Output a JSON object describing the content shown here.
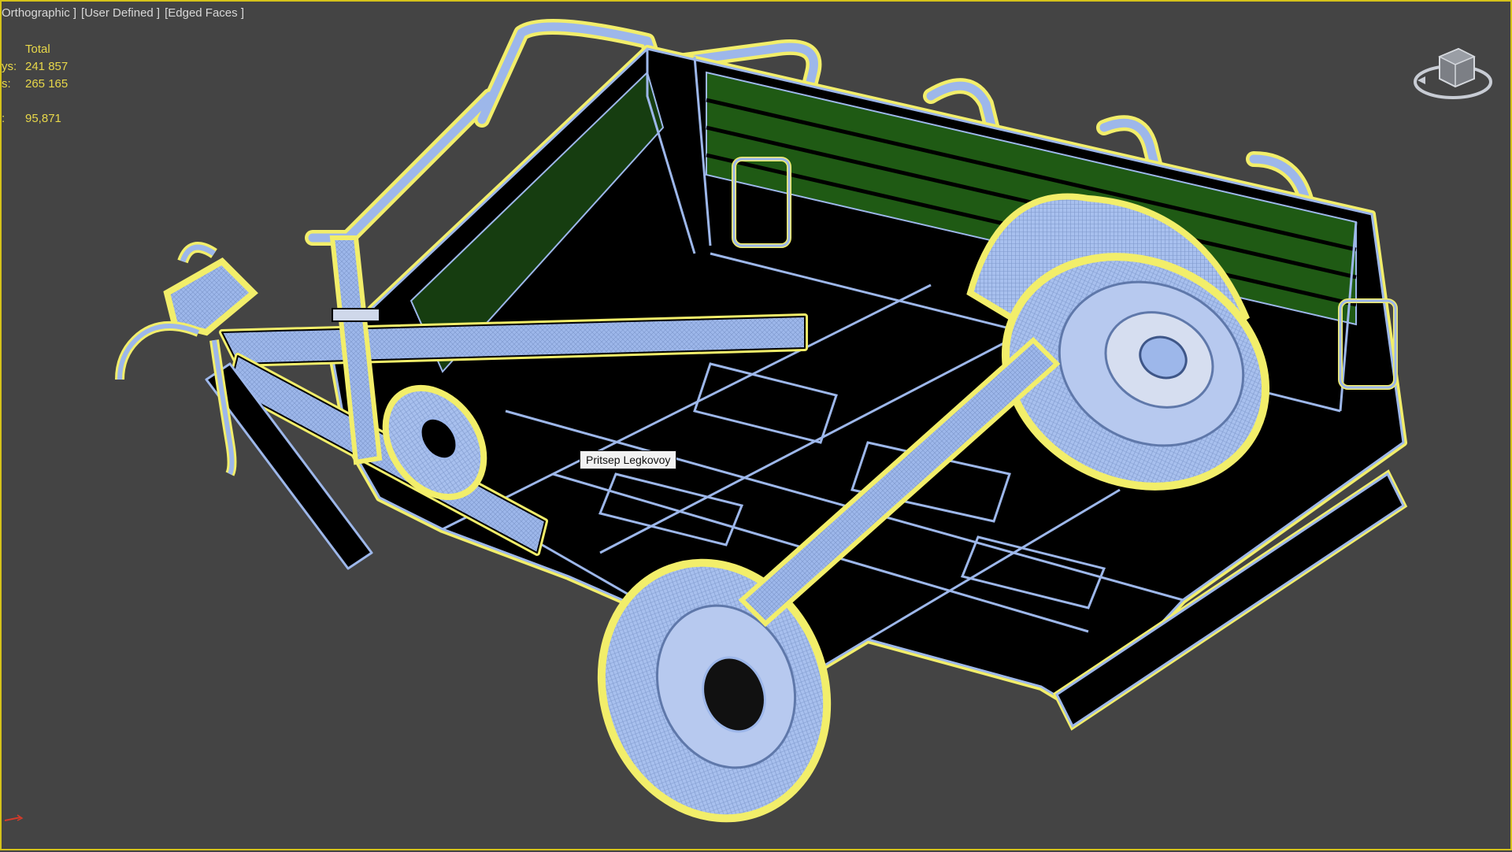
{
  "viewport": {
    "labels": [
      "Orthographic ]",
      "[User Defined ]",
      "[Edged Faces ]"
    ]
  },
  "stats": {
    "header": "Total",
    "rows": [
      {
        "key": "ys:",
        "value": "241 857"
      },
      {
        "key": "s:",
        "value": "265 165"
      },
      {
        "key": ":",
        "value": "95,871"
      }
    ]
  },
  "tooltip": {
    "text": "Pritsep Legkovoy"
  },
  "colors": {
    "background": "#444444",
    "wire": "#9db7ea",
    "selection": "#f2ee6a",
    "body": "#000000",
    "green_panel": "#1f5a14",
    "stats_text": "#e8d84a"
  },
  "icons": {
    "viewcube": "viewcube-icon",
    "axis": "axis-gizmo-icon"
  }
}
